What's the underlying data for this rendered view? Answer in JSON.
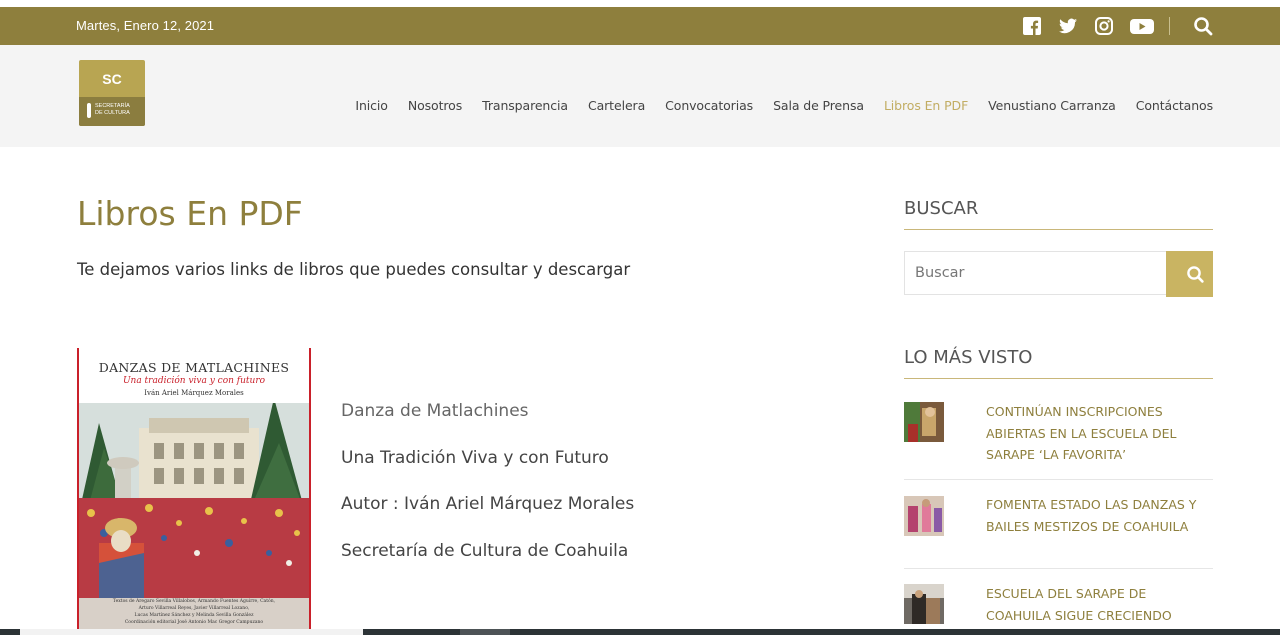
{
  "topbar": {
    "date": "Martes, Enero 12, 2021",
    "social_icons": [
      "facebook-icon",
      "twitter-icon",
      "instagram-icon",
      "youtube-icon",
      "search-icon"
    ],
    "background_color": "#8e7f3d"
  },
  "logo": {
    "abbr": "SC",
    "line1": "SECRETARÍA",
    "line2": "DE CULTURA"
  },
  "nav": {
    "items": [
      {
        "label": "Inicio"
      },
      {
        "label": "Nosotros"
      },
      {
        "label": "Transparencia"
      },
      {
        "label": "Cartelera"
      },
      {
        "label": "Convocatorias"
      },
      {
        "label": "Sala de Prensa"
      },
      {
        "label": "Libros En PDF",
        "active": true
      },
      {
        "label": "Venustiano Carranza"
      },
      {
        "label": "Contáctanos"
      }
    ],
    "active_color": "#c2ad63"
  },
  "main": {
    "title": "Libros En PDF",
    "subtitle": "Te dejamos varios links de libros que puedes consultar y descargar",
    "book": {
      "cover_title": "DANZAS DE MATLACHINES",
      "cover_subtitle": "Una tradición viva y con futuro",
      "cover_author": "Iván Ariel Márquez Morales",
      "cover_credits_1": "Textos de Aregaro Sevilla Villalobos, Armando Fuentes Aguirre, Catón,",
      "cover_credits_2": "Arturo Villarreal Reyes, Javier Villarreal Lozano,",
      "cover_credits_3": "Lucas Martínez Sánchez y Melinda Sevilla González",
      "cover_credits_4": "Coordinación editorial José Antonio Mac Gregor Campuzano"
    },
    "info": {
      "line1": "Danza de Matlachines",
      "line2": "Una Tradición Viva y con Futuro",
      "line3": "Autor : Iván Ariel Márquez Morales",
      "line4": "Secretaría de Cultura de Coahuila"
    }
  },
  "sidebar": {
    "search_heading": "BUSCAR",
    "search_placeholder": "Buscar",
    "most_viewed_heading": "LO MÁS VISTO",
    "posts": [
      {
        "title": "CONTINÚAN INSCRIPCIONES ABIERTAS EN LA ESCUELA DEL SARAPE ‘LA FAVORITA’"
      },
      {
        "title": "FOMENTA ESTADO LAS DANZAS Y BAILES MESTIZOS DE COAHUILA"
      },
      {
        "title": "ESCUELA DEL SARAPE DE COAHUILA SIGUE CRECIENDO"
      }
    ],
    "accent_color": "#c9b462"
  }
}
